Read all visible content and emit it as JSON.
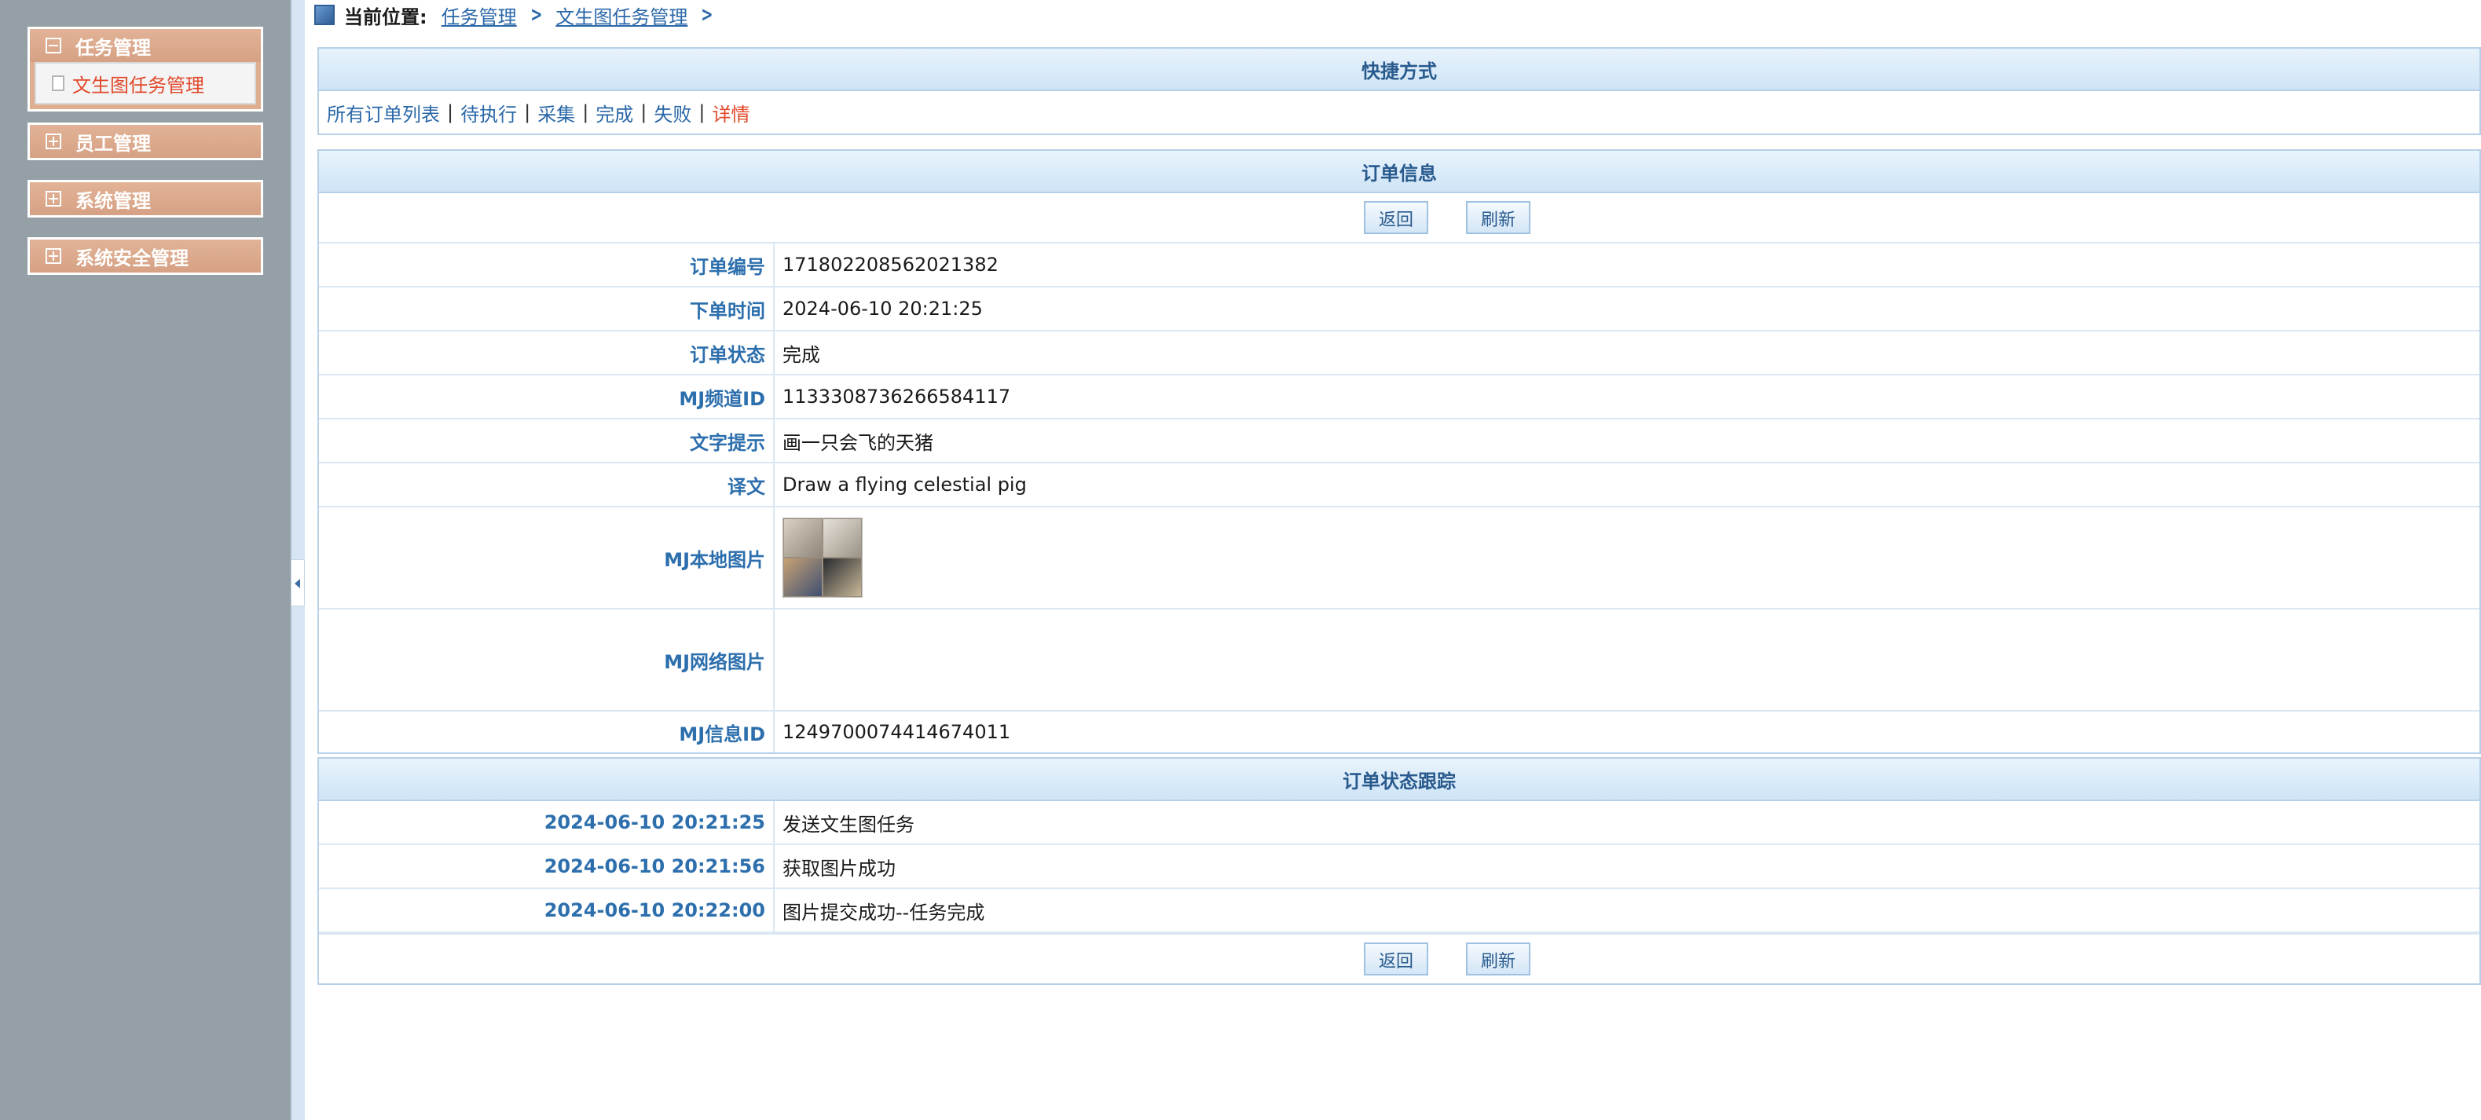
{
  "sidebar": {
    "groups": [
      {
        "label": "任务管理",
        "expanded": true,
        "items": [
          "文生图任务管理"
        ]
      },
      {
        "label": "员工管理",
        "expanded": false
      },
      {
        "label": "系统管理",
        "expanded": false
      },
      {
        "label": "系统安全管理",
        "expanded": false
      }
    ]
  },
  "breadcrumb": {
    "label": "当前位置:",
    "items": [
      "任务管理",
      "文生图任务管理"
    ]
  },
  "quick": {
    "title": "快捷方式",
    "links": [
      "所有订单列表",
      "待执行",
      "采集",
      "完成",
      "失败",
      "详情"
    ],
    "separator": "|"
  },
  "order": {
    "title": "订单信息",
    "back_label": "返回",
    "refresh_label": "刷新",
    "fields": [
      {
        "label": "订单编号",
        "value": "1718022085620213​82"
      },
      {
        "label": "下单时间",
        "value": "2024-06-10 20:21:25"
      },
      {
        "label": "订单状态",
        "value": "完成"
      },
      {
        "label": "MJ频道ID",
        "value": "1133308736266584117"
      },
      {
        "label": "文字提示",
        "value": "画一只会飞的天猪"
      },
      {
        "label": "译文",
        "value": "Draw a flying celestial pig"
      },
      {
        "label": "MJ本地图片",
        "value": ""
      },
      {
        "label": "MJ网络图片",
        "value": ""
      },
      {
        "label": "MJ信息ID",
        "value": "1249700074414674011"
      }
    ]
  },
  "tracking": {
    "title": "订单状态跟踪",
    "entries": [
      {
        "time": "2024-06-10 20:21:25",
        "text": "发送文生图任务"
      },
      {
        "time": "2024-06-10 20:21:56",
        "text": "获取图片成功"
      },
      {
        "time": "2024-06-10 20:22:00",
        "text": "图片提交成功--任务完成"
      }
    ],
    "back_label": "返回",
    "refresh_label": "刷新"
  }
}
